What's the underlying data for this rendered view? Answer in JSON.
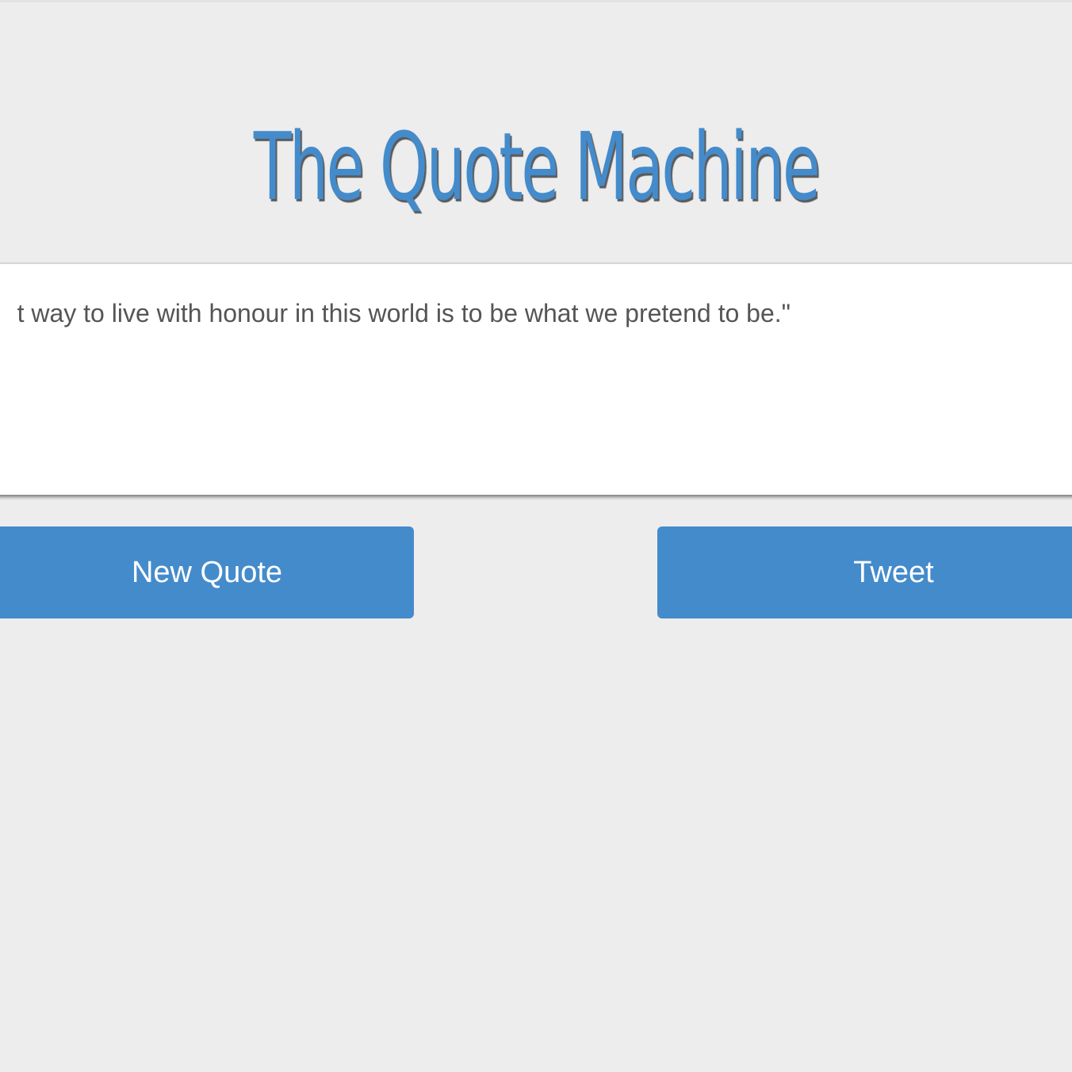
{
  "app": {
    "title": "The Quote Machine"
  },
  "quote": {
    "text": "t way to live with honour in this world is to be what we pretend to be.\""
  },
  "buttons": {
    "new_quote_label": "New Quote",
    "tweet_label": "Tweet"
  },
  "colors": {
    "accent": "#448bcb",
    "background": "#ededed",
    "card": "#ffffff",
    "quote_text": "#555555"
  }
}
